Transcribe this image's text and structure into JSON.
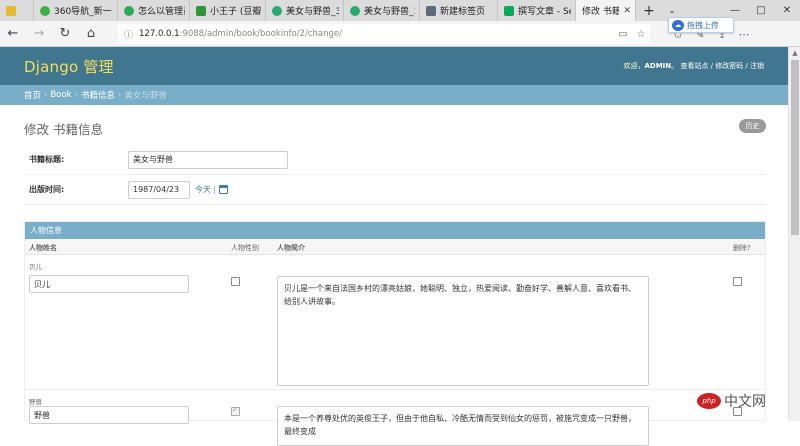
{
  "browser": {
    "tabs": [
      {
        "title": "360导航_新一",
        "favicon_color": "#3fae49"
      },
      {
        "title": "怎么以管理员",
        "favicon_color": "#2eaa5c"
      },
      {
        "title": "小王子 (豆瓣)",
        "favicon_color": "#2e963d"
      },
      {
        "title": "美女与野兽_3",
        "favicon_color": "#29a872"
      },
      {
        "title": "美女与野兽_3",
        "favicon_color": "#29a872"
      },
      {
        "title": "新建标签页",
        "favicon_color": "#5b6b7b"
      },
      {
        "title": "撰写文章 - Se",
        "favicon_color": "#0aa85a"
      },
      {
        "title": "修改 书籍",
        "favicon_color": "#f4f4f4",
        "active": true
      }
    ],
    "new_tab_symbol": "+",
    "tab_list_symbol": "⌄",
    "window_controls": {
      "minimize": "—",
      "maximize": "□",
      "close": "✕"
    },
    "nav": {
      "back": "←",
      "forward": "→",
      "refresh": "↻",
      "home": "⌂"
    },
    "url": {
      "host": "127.0.0.1",
      "rest": ":9088/admin/book/bookinfo/2/change/",
      "lock_symbol": "ⓘ"
    },
    "url_icons": {
      "reader": "▭",
      "favorite": "☆"
    },
    "toolbar_icons": {
      "favorites": "✩",
      "pen": "✎",
      "share": "⇪",
      "more": "⋯"
    },
    "upload_popup": {
      "label": "拖拽上传",
      "icon": "upload-cloud-icon"
    }
  },
  "header": {
    "branding": "Django 管理",
    "welcome": "欢迎，",
    "username": "ADMIN",
    "period": "。",
    "view_site": "查看站点",
    "divider1": " / ",
    "change_password": "修改密码",
    "divider2": " / ",
    "logout": "注销"
  },
  "breadcrumbs": {
    "home": "首页",
    "app": "Book",
    "model": "书籍信息",
    "current": "美女与野兽",
    "separator": "›"
  },
  "page": {
    "title": "修改 书籍信息",
    "history_button": "历史"
  },
  "form": {
    "title_label": "书籍标题:",
    "title_value": "美女与野兽",
    "date_label": "出版时间:",
    "date_value": "1987/04/23",
    "today_link": "今天",
    "today_separator": "|"
  },
  "inline": {
    "caption": "人物信息",
    "columns": {
      "name": "人物姓名",
      "gender": "人物性别",
      "intro": "人物简介",
      "delete": "删除?"
    },
    "rows": [
      {
        "original": "贝儿",
        "name": "贝儿",
        "gender_checked": false,
        "intro": "贝儿是一个来自法国乡村的漂亮姑娘，她聪明、独立，热爱阅读、勤奋好学、善解人意、喜欢看书、给别人讲故事。",
        "delete_checked": false
      },
      {
        "original": "野兽",
        "name": "野兽",
        "gender_checked": true,
        "intro": "本是一个养尊处优的英俊王子，但由于他自私、冷酷无情而受到仙女的惩罚，被施咒变成一只野兽，最终变成",
        "delete_checked": false
      }
    ]
  },
  "watermark": {
    "badge": "php",
    "text": "中文网"
  },
  "colors": {
    "header": "#417690",
    "branding": "#f5dd5d",
    "breadcrumbs": "#79aec8",
    "link": "#447e9b"
  }
}
